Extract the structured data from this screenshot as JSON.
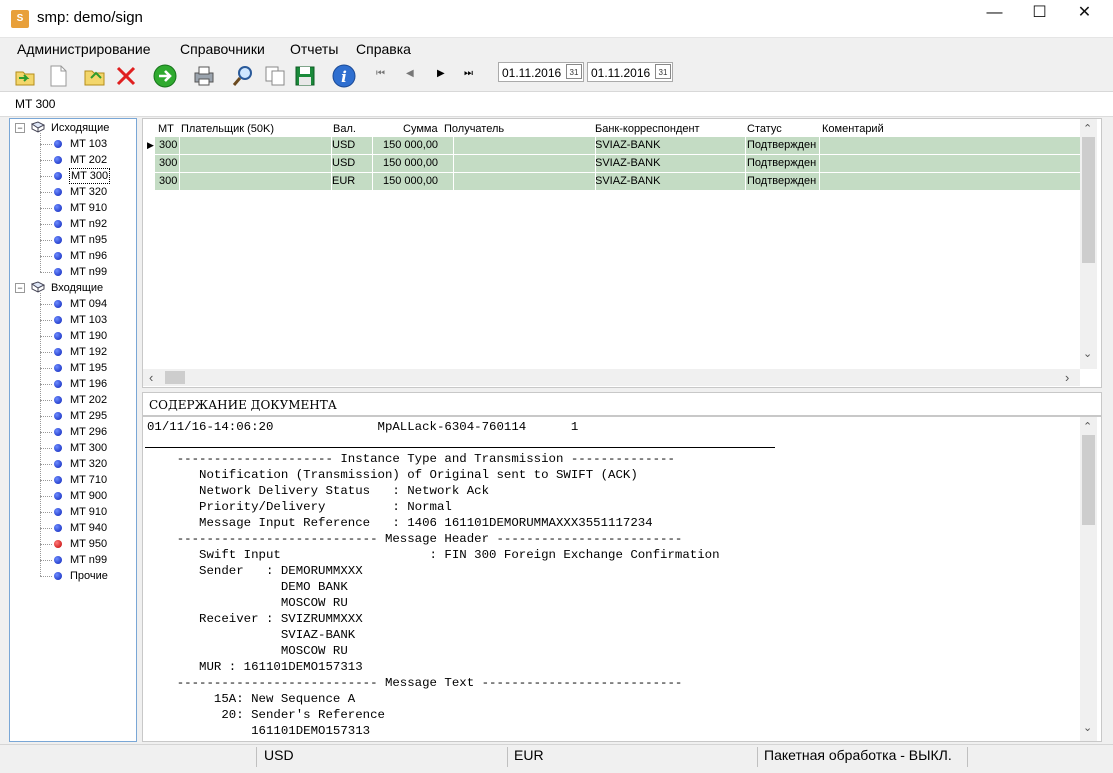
{
  "window": {
    "title": "smp: demo/sign",
    "app_icon": "S"
  },
  "menu": [
    "Администрирование",
    "Справочники",
    "Отчеты",
    "Справка"
  ],
  "toolbar": {
    "date_from": "01.11.2016",
    "date_to": "01.11.2016",
    "calendar_label": "31"
  },
  "section_label": "MT 300",
  "tree": {
    "outgoing_label": "Исходящие",
    "outgoing": [
      "MT 103",
      "MT 202",
      "MT 300",
      "MT 320",
      "MT 910",
      "MT n92",
      "MT n95",
      "MT n96",
      "MT n99"
    ],
    "incoming_label": "Входящие",
    "incoming": [
      "MT 094",
      "MT 103",
      "MT 190",
      "MT 192",
      "MT 195",
      "MT 196",
      "MT 202",
      "MT 295",
      "MT 296",
      "MT 300",
      "MT 320",
      "MT 710",
      "MT 900",
      "MT 910",
      "MT 940",
      "MT 950",
      "MT n99",
      "Прочие"
    ],
    "selected": "MT 300",
    "red_item": "MT 950"
  },
  "grid": {
    "columns": [
      "MT",
      "Плательщик (50K)",
      "Вал.",
      "Сумма",
      "Получатель",
      "Банк-корреспондент",
      "Статус",
      "Коментарий"
    ],
    "rows": [
      {
        "mt": "300",
        "payer": "",
        "cur": "USD",
        "sum": "150 000,00",
        "recv": "",
        "bank": "SVIAZ-BANK",
        "status": "Подтвержден",
        "comment": ""
      },
      {
        "mt": "300",
        "payer": "",
        "cur": "USD",
        "sum": "150 000,00",
        "recv": "",
        "bank": "SVIAZ-BANK",
        "status": "Подтвержден",
        "comment": ""
      },
      {
        "mt": "300",
        "payer": "",
        "cur": "EUR",
        "sum": "150 000,00",
        "recv": "",
        "bank": "SVIAZ-BANK",
        "status": "Подтвержден",
        "comment": ""
      }
    ]
  },
  "document": {
    "header": "СОДЕРЖАНИЕ ДОКУМЕНТА",
    "lines": [
      "01/11/16-14:06:20              MpALLack-6304-760114      1",
      "",
      "    --------------------- Instance Type and Transmission --------------",
      "       Notification (Transmission) of Original sent to SWIFT (ACK)",
      "       Network Delivery Status   : Network Ack",
      "       Priority/Delivery         : Normal",
      "       Message Input Reference   : 1406 161101DEMORUMMAXXX3551117234",
      "    --------------------------- Message Header -------------------------",
      "       Swift Input                    : FIN 300 Foreign Exchange Confirmation",
      "       Sender   : DEMORUMMXXX",
      "                  DEMO BANK",
      "                  MOSCOW RU",
      "       Receiver : SVIZRUMMXXX",
      "                  SVIAZ-BANK",
      "                  MOSCOW RU",
      "       MUR : 161101DEMO157313",
      "    --------------------------- Message Text ---------------------------",
      "         15A: New Sequence A",
      "          20: Sender's Reference",
      "              161101DEMO157313"
    ]
  },
  "status": {
    "cur1": "USD",
    "cur2": "EUR",
    "batch": "Пакетная обработка - ВЫКЛ."
  }
}
